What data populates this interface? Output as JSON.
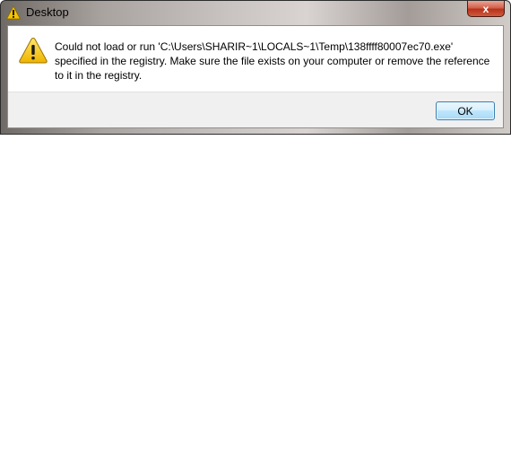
{
  "window": {
    "title": "Desktop",
    "title_icon": "warning-icon",
    "close_label": "x"
  },
  "dialog": {
    "icon": "warning-icon",
    "message": "Could not load or run 'C:\\Users\\SHARIR~1\\LOCALS~1\\Temp\\138ffff80007ec70.exe' specified in the registry. Make sure the file exists on your computer or remove the reference to it in the registry.",
    "ok_label": "OK"
  },
  "colors": {
    "warning_fill": "#f5c400",
    "close_button": "#c4442b",
    "ok_border": "#3c7fb1"
  }
}
